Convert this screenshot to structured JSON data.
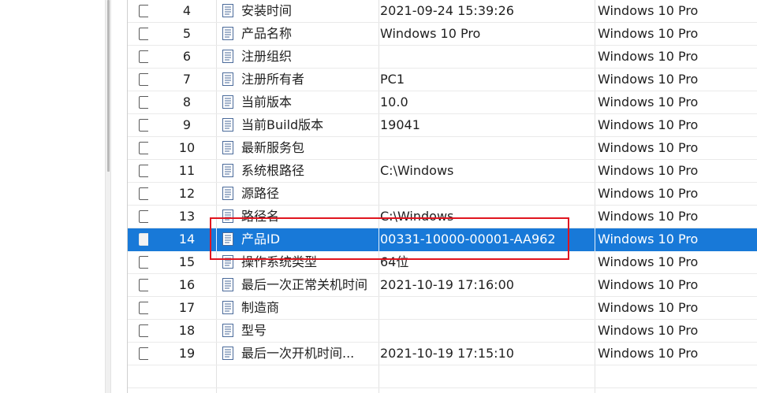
{
  "accent": "#1879d8",
  "annotation_color": "#e0151f",
  "rows": [
    {
      "num": "4",
      "name": "安装时间",
      "value": "2021-09-24 15:39:26",
      "os": "Windows 10 Pro"
    },
    {
      "num": "5",
      "name": "产品名称",
      "value": "Windows 10 Pro",
      "os": "Windows 10 Pro"
    },
    {
      "num": "6",
      "name": "注册组织",
      "value": "",
      "os": "Windows 10 Pro"
    },
    {
      "num": "7",
      "name": "注册所有者",
      "value": "PC1",
      "os": "Windows 10 Pro"
    },
    {
      "num": "8",
      "name": "当前版本",
      "value": "10.0",
      "os": "Windows 10 Pro"
    },
    {
      "num": "9",
      "name": "当前Build版本",
      "value": "19041",
      "os": "Windows 10 Pro"
    },
    {
      "num": "10",
      "name": "最新服务包",
      "value": "",
      "os": "Windows 10 Pro"
    },
    {
      "num": "11",
      "name": "系统根路径",
      "value": "C:\\Windows",
      "os": "Windows 10 Pro"
    },
    {
      "num": "12",
      "name": "源路径",
      "value": "",
      "os": "Windows 10 Pro"
    },
    {
      "num": "13",
      "name": "路径名",
      "value": "C:\\Windows",
      "os": "Windows 10 Pro"
    },
    {
      "num": "14",
      "name": "产品ID",
      "value": "00331-10000-00001-AA962",
      "os": "Windows 10 Pro",
      "selected": true
    },
    {
      "num": "15",
      "name": "操作系统类型",
      "value": "64位",
      "os": "Windows 10 Pro"
    },
    {
      "num": "16",
      "name": "最后一次正常关机时间",
      "value": "2021-10-19 17:16:00",
      "os": "Windows 10 Pro"
    },
    {
      "num": "17",
      "name": "制造商",
      "value": "",
      "os": "Windows 10 Pro"
    },
    {
      "num": "18",
      "name": "型号",
      "value": "",
      "os": "Windows 10 Pro"
    },
    {
      "num": "19",
      "name": "最后一次开机时间...",
      "value": "2021-10-19 17:15:10",
      "os": "Windows 10 Pro"
    }
  ]
}
